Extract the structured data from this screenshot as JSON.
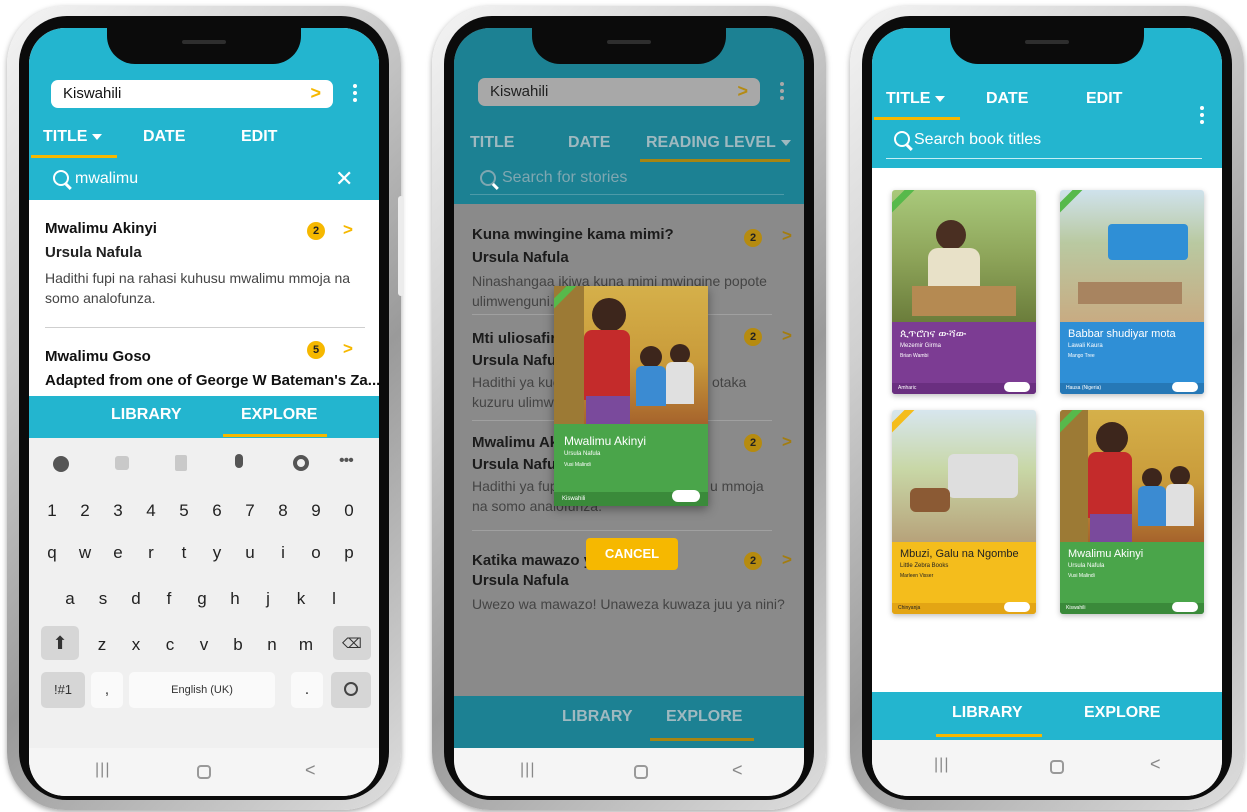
{
  "colors": {
    "teal": "#23b5cf",
    "dark_teal": "#1c8193",
    "accent_yellow": "#f6b800",
    "book_green": "#4aa54a",
    "book_purple": "#7c3c93",
    "book_blue": "#2f8fd6",
    "book_yellow": "#f4bd1c"
  },
  "phone1": {
    "language": "Kiswahili",
    "tabs": [
      "TITLE",
      "DATE",
      "EDIT"
    ],
    "search_value": "mwalimu",
    "results": [
      {
        "title": "Mwalimu Akinyi",
        "author": "Ursula Nafula",
        "desc": "Hadithi fupi na rahasi kuhusu mwalimu mmoja na somo analofunza.",
        "badge": "2"
      },
      {
        "title": "Mwalimu Goso",
        "subtitle": "Adapted from one of George W Bateman's Za...",
        "badge": "5"
      }
    ],
    "bottom_tabs": [
      "LIBRARY",
      "EXPLORE"
    ],
    "keyboard": {
      "numbers": [
        "1",
        "2",
        "3",
        "4",
        "5",
        "6",
        "7",
        "8",
        "9",
        "0"
      ],
      "row1": [
        "q",
        "w",
        "e",
        "r",
        "t",
        "y",
        "u",
        "i",
        "o",
        "p"
      ],
      "row2": [
        "a",
        "s",
        "d",
        "f",
        "g",
        "h",
        "j",
        "k",
        "l"
      ],
      "row3": [
        "z",
        "x",
        "c",
        "v",
        "b",
        "n",
        "m"
      ],
      "symbols_key": "!#1",
      "comma_key": ",",
      "space_key": "English (UK)",
      "period_key": "."
    }
  },
  "phone2": {
    "language": "Kiswahili",
    "tabs": [
      "TITLE",
      "DATE",
      "READING LEVEL"
    ],
    "search_placeholder": "Search for stories",
    "results": [
      {
        "title": "Kuna mwingine kama mimi?",
        "author": "Ursula Nafula",
        "desc": "Ninashangaa ikiwa kuna mimi mwingine popote ulimwenguni.",
        "badge": "2"
      },
      {
        "title": "Mti uliosafir",
        "author": "Ursula Nafula",
        "desc_a": "Hadithi ya kuc",
        "desc_b": "otaka",
        "desc_c": "kuzuru ulimwe",
        "badge": "2"
      },
      {
        "title": "Mwalimu Ak",
        "author": "Ursula Nafula",
        "desc_a": "Hadithi ya fup",
        "desc_b": "u mmoja",
        "desc_c": "na somo analofunza.",
        "badge": "2"
      },
      {
        "title": "Katika mawazo y",
        "author": "Ursula Nafula",
        "desc": "Uwezo wa mawazo! Unaweza kuwaza juu ya nini?",
        "badge": "2"
      }
    ],
    "popup_book": {
      "title": "Mwalimu Akinyi",
      "author": "Ursula Nafula",
      "illustrator": "Vusi Malindi",
      "language": "Kiswahili"
    },
    "cancel_label": "CANCEL",
    "bottom_tabs": [
      "LIBRARY",
      "EXPLORE"
    ]
  },
  "phone3": {
    "tabs": [
      "TITLE",
      "DATE",
      "EDIT"
    ],
    "search_placeholder": "Search book titles",
    "books": [
      {
        "title": "ጲጥሮስና ውሻው",
        "author": "Mezemir Girma",
        "illustrator": "Brian Wambi",
        "language": "Amharic"
      },
      {
        "title": "Babbar shudiyar mota",
        "author": "Lawali Kaura",
        "illustrator": "Mango Tree",
        "language": "Hausa (Nigeria)"
      },
      {
        "title": "Mbuzi, Galu na Ngombe",
        "author": "Little Zebra Books",
        "illustrator": "Marleen Visser",
        "language": "Chinyanja"
      },
      {
        "title": "Mwalimu Akinyi",
        "author": "Ursula Nafula",
        "illustrator": "Vusi Malindi",
        "language": "Kiswahili"
      }
    ],
    "bottom_tabs": [
      "LIBRARY",
      "EXPLORE"
    ]
  }
}
